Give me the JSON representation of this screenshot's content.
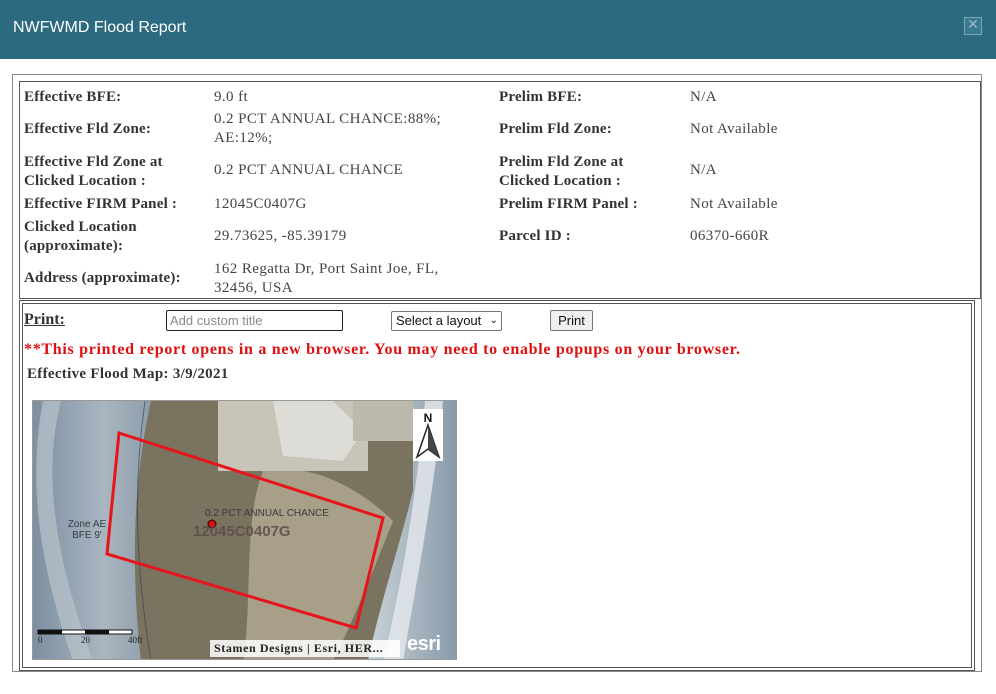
{
  "window": {
    "title": "NWFWMD Flood Report",
    "close_glyph": "✕",
    "close_icon": "close-icon"
  },
  "report": {
    "left": [
      {
        "label": "Effective BFE:",
        "value": "9.0  ft"
      },
      {
        "label": "Effective Fld Zone:",
        "value": "0.2 PCT ANNUAL CHANCE:88%; AE:12%;"
      },
      {
        "label": "Effective Fld Zone at Clicked Location :",
        "value": "0.2 PCT ANNUAL CHANCE"
      },
      {
        "label": "Effective FIRM Panel :",
        "value": "12045C0407G"
      },
      {
        "label": "Clicked Location (approximate):",
        "value": "29.73625, -85.39179"
      },
      {
        "label": "Address (approximate):",
        "value": "162 Regatta Dr, Port Saint Joe, FL, 32456, USA"
      }
    ],
    "right": [
      {
        "label": "Prelim BFE:",
        "value": "N/A"
      },
      {
        "label": "Prelim Fld Zone:",
        "value": "Not Available"
      },
      {
        "label": "Prelim Fld Zone at Clicked Location :",
        "value": "N/A"
      },
      {
        "label": "Prelim FIRM Panel :",
        "value": "Not Available"
      },
      {
        "label": "Parcel ID :",
        "value": "06370-660R"
      }
    ]
  },
  "print": {
    "label": "Print:",
    "title_placeholder": "Add custom title",
    "layout_selected": "Select a layout",
    "button_label": "Print",
    "warning": "**This printed report opens in a new browser. You may need to enable popups on your browser.",
    "map_title": "Effective Flood Map: 3/9/2021"
  },
  "map": {
    "north_label": "N",
    "zone_label_line1": "Zone AE",
    "zone_label_line2": "BFE 9'",
    "zone_text": "0.2 PCT ANNUAL CHANCE",
    "panel_text": "12045C0407G",
    "scale_ticks": [
      "0",
      "20",
      "40ft"
    ],
    "attribution": "Stamen Designs | Esri, HER...",
    "logo_text": "esri",
    "parcel_color": "#e8141b",
    "point_color": "#d01010"
  }
}
